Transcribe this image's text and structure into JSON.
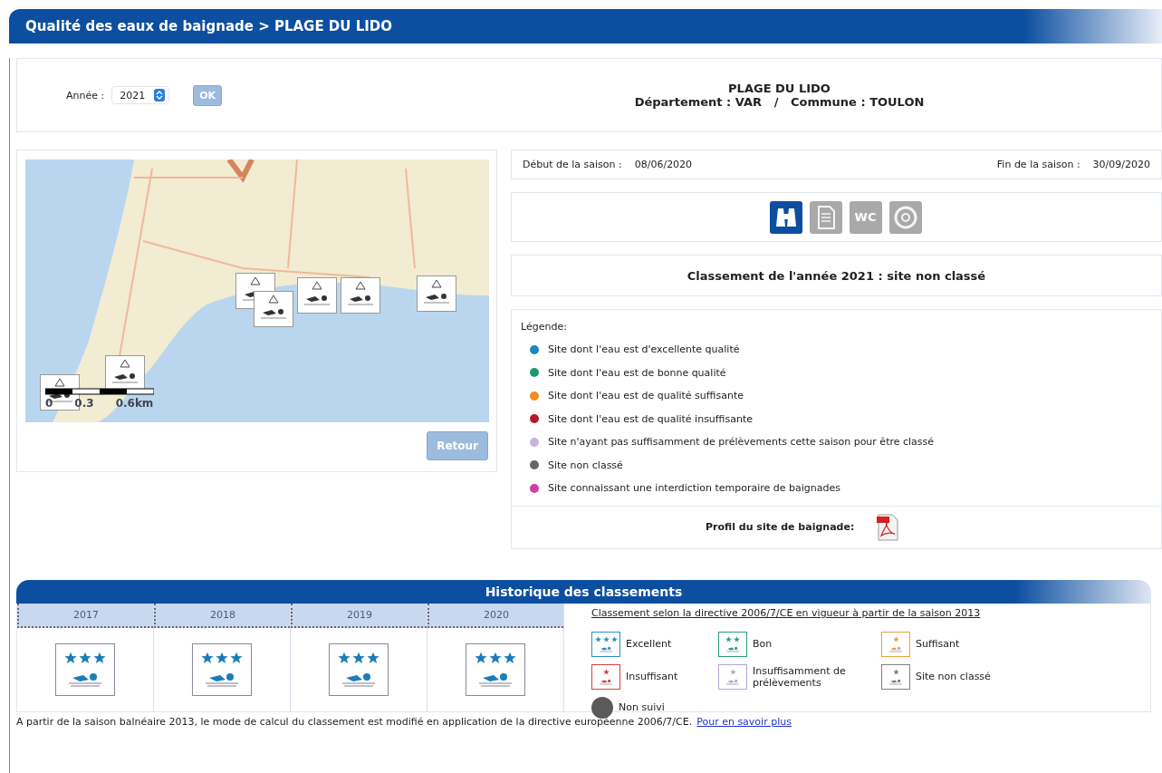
{
  "header": {
    "title": "Qualité des eaux de baignade > PLAGE DU LIDO"
  },
  "year_selector": {
    "label": "Année :",
    "value": "2021",
    "button": "OK"
  },
  "site": {
    "name": "PLAGE DU LIDO",
    "location": "Département : VAR   /   Commune : TOULON"
  },
  "map": {
    "scale_labels": [
      "0",
      "0.3",
      "0.6km"
    ]
  },
  "back_button": "Retour",
  "season": {
    "start_label": "Début de la saison :",
    "start": "08/06/2020",
    "end_label": "Fin de la saison :",
    "end": "30/09/2020"
  },
  "facilities": [
    {
      "kind": "binoculars",
      "enabled": true
    },
    {
      "kind": "document",
      "enabled": false
    },
    {
      "kind": "wc",
      "label": "WC",
      "enabled": false
    },
    {
      "kind": "lifebuoy",
      "enabled": false
    }
  ],
  "classification": "Classement de l'année 2021 : site non classé",
  "legend": {
    "title": "Légende:",
    "items": [
      {
        "text": "Site dont l'eau est d'excellente qualité",
        "color": "#1b86c0"
      },
      {
        "text": "Site dont l'eau est de bonne qualité",
        "color": "#1a9a6a"
      },
      {
        "text": "Site dont l'eau est de qualité suffisante",
        "color": "#f28c1a"
      },
      {
        "text": "Site dont l'eau est de qualité insuffisante",
        "color": "#b8182a"
      },
      {
        "text": "Site n'ayant pas suffisamment de prélèvements cette saison pour être classé",
        "color": "#c8b4dc"
      },
      {
        "text": "Site non classé",
        "color": "#666666"
      },
      {
        "text": "Site connaissant une interdiction temporaire de baignades",
        "color": "#d13fa4"
      }
    ]
  },
  "profile": {
    "label": "Profil du site de baignade:"
  },
  "history": {
    "title": "Historique des classements",
    "years": [
      {
        "year": "2017",
        "stars": 3
      },
      {
        "year": "2018",
        "stars": 3
      },
      {
        "year": "2019",
        "stars": 3
      },
      {
        "year": "2020",
        "stars": 3
      }
    ],
    "directive_title": "Classement selon la directive 2006/7/CE en vigueur à partir de la saison 2013",
    "classes": [
      {
        "kind": "three_star",
        "label": "Excellent",
        "color": "#2a8fc8"
      },
      {
        "kind": "two_star",
        "label": "Bon",
        "color": "#2aa070"
      },
      {
        "kind": "one_star",
        "label": "Suffisant",
        "color": "#e8a040"
      },
      {
        "kind": "one_star",
        "label": "Insuffisant",
        "color": "#d84040"
      },
      {
        "kind": "one_star",
        "label": "Insuffisamment de prélèvements",
        "color": "#b0a8d8"
      },
      {
        "kind": "one_star",
        "label": "Site non classé",
        "color": "#808080"
      },
      {
        "kind": "dot",
        "label": "Non suivi",
        "color": "#5a5a5a"
      }
    ]
  },
  "footer": {
    "text": "A partir de la saison balnéaire 2013, le mode de calcul du classement est modifié en application de la directive européenne 2006/7/CE.",
    "link": "Pour en savoir plus"
  }
}
